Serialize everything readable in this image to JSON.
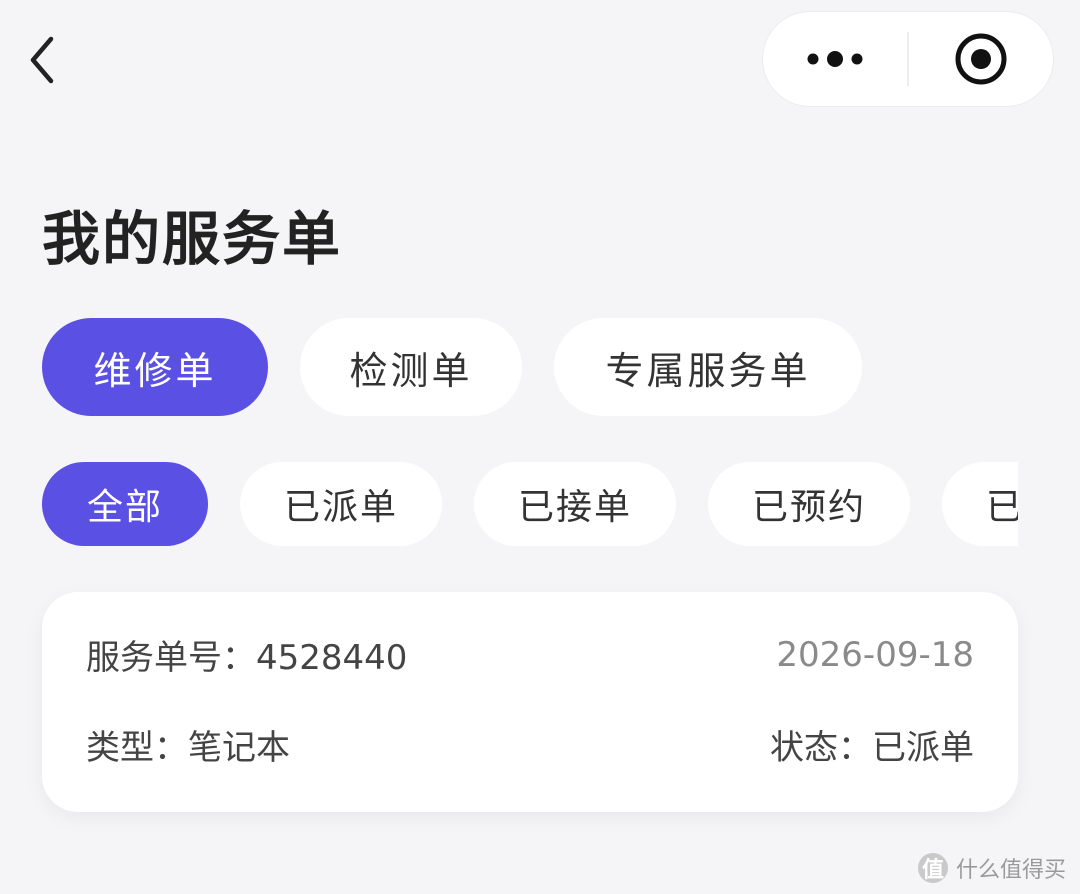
{
  "header": {
    "back_icon": "chevron-left-icon",
    "more_icon": "more-dots-icon",
    "close_icon": "target-circle-icon"
  },
  "page": {
    "title": "我的服务单"
  },
  "tabs": [
    {
      "label": "维修单",
      "active": true
    },
    {
      "label": "检测单",
      "active": false
    },
    {
      "label": "专属服务单",
      "active": false
    }
  ],
  "filters": [
    {
      "label": "全部",
      "active": true
    },
    {
      "label": "已派单",
      "active": false
    },
    {
      "label": "已接单",
      "active": false
    },
    {
      "label": "已预约",
      "active": false
    },
    {
      "label": "已完成",
      "active": false
    }
  ],
  "order": {
    "number_label": "服务单号：",
    "number": "4528440",
    "date": "2026-09-18",
    "type_label": "类型：",
    "type": "笔记本",
    "status_label": "状态：",
    "status": "已派单"
  },
  "watermark": {
    "logo_text": "值",
    "text": "什么值得买"
  },
  "colors": {
    "accent": "#5a50e3",
    "background": "#f5f5f7",
    "card": "#ffffff"
  }
}
